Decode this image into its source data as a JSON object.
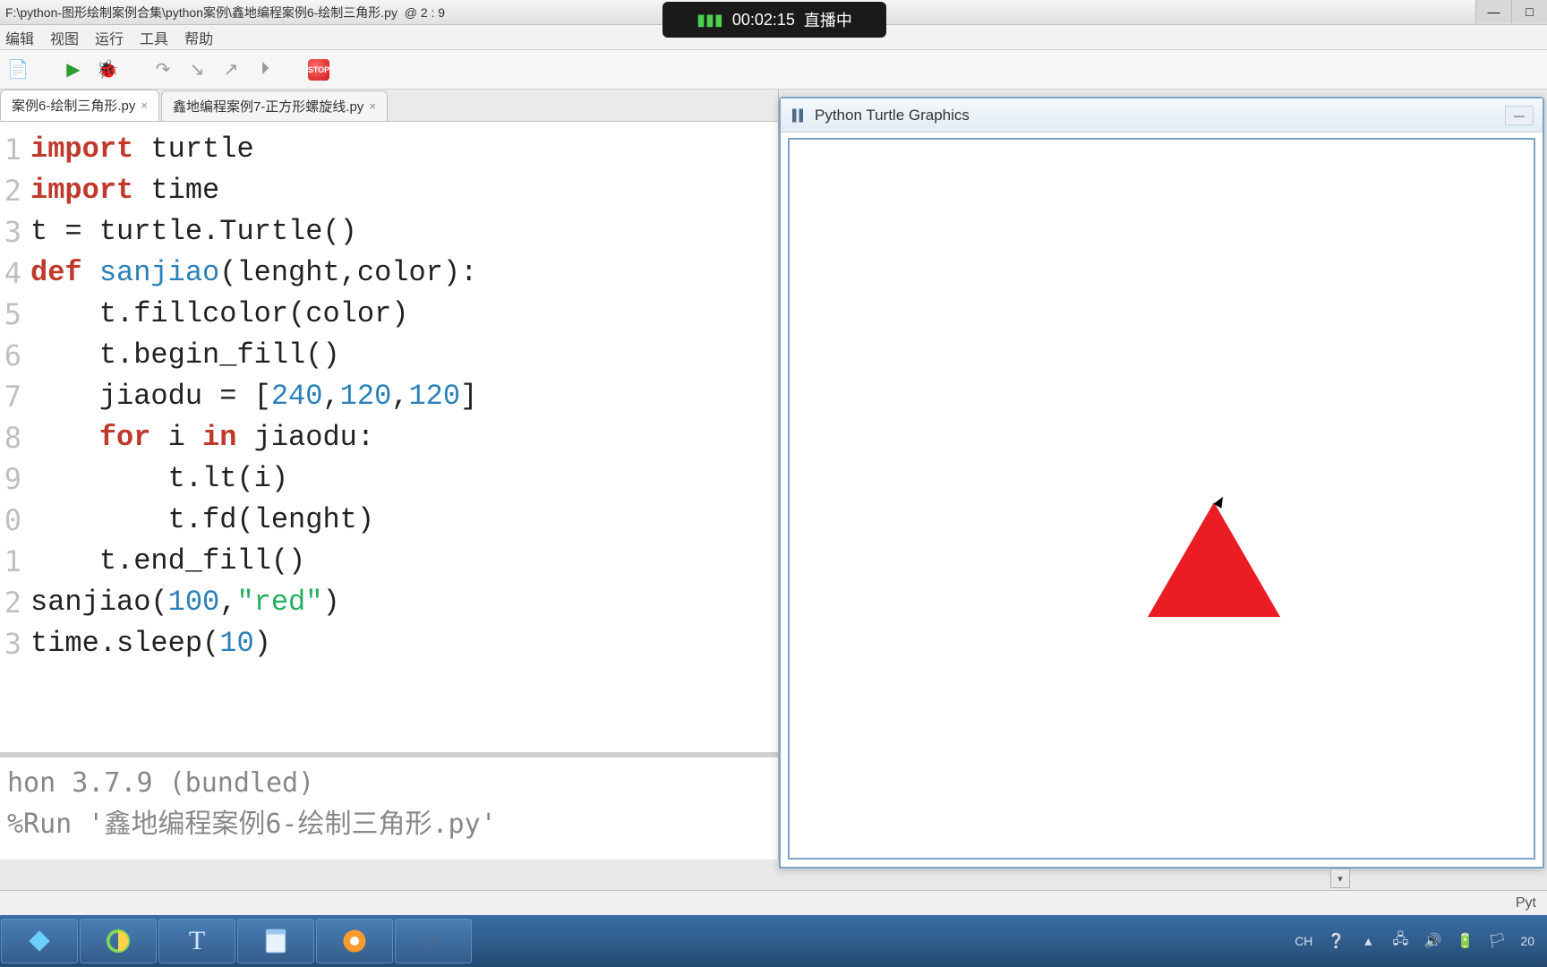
{
  "title": {
    "path": "F:\\python-图形绘制案例合集\\python案例\\鑫地编程案例6-绘制三角形.py",
    "cursor_pos": "@  2 : 9"
  },
  "menu": {
    "edit": "编辑",
    "view": "视图",
    "run": "运行",
    "tools": "工具",
    "help": "帮助"
  },
  "tabs": {
    "t1": "案例6-绘制三角形.py",
    "t2": "鑫地编程案例7-正方形螺旋线.py"
  },
  "code_tokens": {
    "l1_kw": "import",
    "l1_tur": " turtle",
    "l2_kw": "import",
    "l2_time": " time",
    "l3": "t = turtle.Turtle()",
    "l4_def": "def",
    "l4_name": " sanjiao",
    "l4_rest": "(lenght,color):",
    "l5": "    t.fillcolor(color)",
    "l6": "    t.begin_fill()",
    "l7a": "    jiaodu = [",
    "l7n1": "240",
    "l7c1": ",",
    "l7n2": "120",
    "l7c2": ",",
    "l7n3": "120",
    "l7b": "]",
    "l8_for": "    for",
    "l8_i": " i ",
    "l8_in": "in",
    "l8_rest": " jiaodu:",
    "l9": "        t.lt(i)",
    "l10": "        t.fd(lenght)",
    "l11": "    t.end_fill()",
    "l12a": "sanjiao(",
    "l12n": "100",
    "l12c": ",",
    "l12s": "\"red\"",
    "l12b": ")",
    "l13a": "time.sleep(",
    "l13n": "10",
    "l13b": ")"
  },
  "gutter": [
    "1",
    "2",
    "3",
    "4",
    "5",
    "6",
    "7",
    "8",
    "9",
    "0",
    "1",
    "2",
    "3"
  ],
  "shell": {
    "line1": "hon 3.7.9 (bundled)",
    "line2": " %Run '鑫地编程案例6-绘制三角形.py'"
  },
  "turtle_window": {
    "title": "Python Turtle Graphics"
  },
  "stream": {
    "time": "00:02:15",
    "status": "直播中"
  },
  "status_bar": {
    "right": "Pyt"
  },
  "stop_label": "STOP",
  "systray": {
    "ime": "CH",
    "time": "20"
  }
}
